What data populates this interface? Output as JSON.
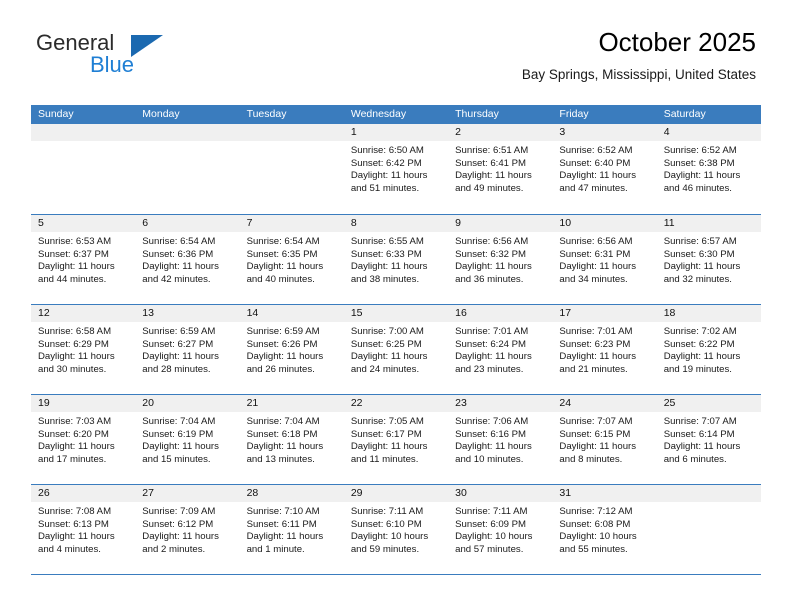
{
  "brand": {
    "name_part1": "General",
    "name_part2": "Blue",
    "logo_icon": "triangle-logo-icon"
  },
  "header": {
    "title": "October 2025",
    "subtitle": "Bay Springs, Mississippi, United States"
  },
  "colors": {
    "header_blue": "#3a7cbe",
    "brand_blue": "#1f7fd4",
    "logo_blue": "#1b69b0",
    "day_number_bg": "#f0f0f0",
    "page_bg": "#ffffff"
  },
  "calendar": {
    "weekdays": [
      "Sunday",
      "Monday",
      "Tuesday",
      "Wednesday",
      "Thursday",
      "Friday",
      "Saturday"
    ],
    "weeks": [
      [
        {
          "day": "",
          "empty": true,
          "sunrise": "",
          "sunset": "",
          "daylight1": "",
          "daylight2": ""
        },
        {
          "day": "",
          "empty": true,
          "sunrise": "",
          "sunset": "",
          "daylight1": "",
          "daylight2": ""
        },
        {
          "day": "",
          "empty": true,
          "sunrise": "",
          "sunset": "",
          "daylight1": "",
          "daylight2": ""
        },
        {
          "day": "1",
          "empty": false,
          "sunrise": "Sunrise: 6:50 AM",
          "sunset": "Sunset: 6:42 PM",
          "daylight1": "Daylight: 11 hours",
          "daylight2": "and 51 minutes."
        },
        {
          "day": "2",
          "empty": false,
          "sunrise": "Sunrise: 6:51 AM",
          "sunset": "Sunset: 6:41 PM",
          "daylight1": "Daylight: 11 hours",
          "daylight2": "and 49 minutes."
        },
        {
          "day": "3",
          "empty": false,
          "sunrise": "Sunrise: 6:52 AM",
          "sunset": "Sunset: 6:40 PM",
          "daylight1": "Daylight: 11 hours",
          "daylight2": "and 47 minutes."
        },
        {
          "day": "4",
          "empty": false,
          "sunrise": "Sunrise: 6:52 AM",
          "sunset": "Sunset: 6:38 PM",
          "daylight1": "Daylight: 11 hours",
          "daylight2": "and 46 minutes."
        }
      ],
      [
        {
          "day": "5",
          "empty": false,
          "sunrise": "Sunrise: 6:53 AM",
          "sunset": "Sunset: 6:37 PM",
          "daylight1": "Daylight: 11 hours",
          "daylight2": "and 44 minutes."
        },
        {
          "day": "6",
          "empty": false,
          "sunrise": "Sunrise: 6:54 AM",
          "sunset": "Sunset: 6:36 PM",
          "daylight1": "Daylight: 11 hours",
          "daylight2": "and 42 minutes."
        },
        {
          "day": "7",
          "empty": false,
          "sunrise": "Sunrise: 6:54 AM",
          "sunset": "Sunset: 6:35 PM",
          "daylight1": "Daylight: 11 hours",
          "daylight2": "and 40 minutes."
        },
        {
          "day": "8",
          "empty": false,
          "sunrise": "Sunrise: 6:55 AM",
          "sunset": "Sunset: 6:33 PM",
          "daylight1": "Daylight: 11 hours",
          "daylight2": "and 38 minutes."
        },
        {
          "day": "9",
          "empty": false,
          "sunrise": "Sunrise: 6:56 AM",
          "sunset": "Sunset: 6:32 PM",
          "daylight1": "Daylight: 11 hours",
          "daylight2": "and 36 minutes."
        },
        {
          "day": "10",
          "empty": false,
          "sunrise": "Sunrise: 6:56 AM",
          "sunset": "Sunset: 6:31 PM",
          "daylight1": "Daylight: 11 hours",
          "daylight2": "and 34 minutes."
        },
        {
          "day": "11",
          "empty": false,
          "sunrise": "Sunrise: 6:57 AM",
          "sunset": "Sunset: 6:30 PM",
          "daylight1": "Daylight: 11 hours",
          "daylight2": "and 32 minutes."
        }
      ],
      [
        {
          "day": "12",
          "empty": false,
          "sunrise": "Sunrise: 6:58 AM",
          "sunset": "Sunset: 6:29 PM",
          "daylight1": "Daylight: 11 hours",
          "daylight2": "and 30 minutes."
        },
        {
          "day": "13",
          "empty": false,
          "sunrise": "Sunrise: 6:59 AM",
          "sunset": "Sunset: 6:27 PM",
          "daylight1": "Daylight: 11 hours",
          "daylight2": "and 28 minutes."
        },
        {
          "day": "14",
          "empty": false,
          "sunrise": "Sunrise: 6:59 AM",
          "sunset": "Sunset: 6:26 PM",
          "daylight1": "Daylight: 11 hours",
          "daylight2": "and 26 minutes."
        },
        {
          "day": "15",
          "empty": false,
          "sunrise": "Sunrise: 7:00 AM",
          "sunset": "Sunset: 6:25 PM",
          "daylight1": "Daylight: 11 hours",
          "daylight2": "and 24 minutes."
        },
        {
          "day": "16",
          "empty": false,
          "sunrise": "Sunrise: 7:01 AM",
          "sunset": "Sunset: 6:24 PM",
          "daylight1": "Daylight: 11 hours",
          "daylight2": "and 23 minutes."
        },
        {
          "day": "17",
          "empty": false,
          "sunrise": "Sunrise: 7:01 AM",
          "sunset": "Sunset: 6:23 PM",
          "daylight1": "Daylight: 11 hours",
          "daylight2": "and 21 minutes."
        },
        {
          "day": "18",
          "empty": false,
          "sunrise": "Sunrise: 7:02 AM",
          "sunset": "Sunset: 6:22 PM",
          "daylight1": "Daylight: 11 hours",
          "daylight2": "and 19 minutes."
        }
      ],
      [
        {
          "day": "19",
          "empty": false,
          "sunrise": "Sunrise: 7:03 AM",
          "sunset": "Sunset: 6:20 PM",
          "daylight1": "Daylight: 11 hours",
          "daylight2": "and 17 minutes."
        },
        {
          "day": "20",
          "empty": false,
          "sunrise": "Sunrise: 7:04 AM",
          "sunset": "Sunset: 6:19 PM",
          "daylight1": "Daylight: 11 hours",
          "daylight2": "and 15 minutes."
        },
        {
          "day": "21",
          "empty": false,
          "sunrise": "Sunrise: 7:04 AM",
          "sunset": "Sunset: 6:18 PM",
          "daylight1": "Daylight: 11 hours",
          "daylight2": "and 13 minutes."
        },
        {
          "day": "22",
          "empty": false,
          "sunrise": "Sunrise: 7:05 AM",
          "sunset": "Sunset: 6:17 PM",
          "daylight1": "Daylight: 11 hours",
          "daylight2": "and 11 minutes."
        },
        {
          "day": "23",
          "empty": false,
          "sunrise": "Sunrise: 7:06 AM",
          "sunset": "Sunset: 6:16 PM",
          "daylight1": "Daylight: 11 hours",
          "daylight2": "and 10 minutes."
        },
        {
          "day": "24",
          "empty": false,
          "sunrise": "Sunrise: 7:07 AM",
          "sunset": "Sunset: 6:15 PM",
          "daylight1": "Daylight: 11 hours",
          "daylight2": "and 8 minutes."
        },
        {
          "day": "25",
          "empty": false,
          "sunrise": "Sunrise: 7:07 AM",
          "sunset": "Sunset: 6:14 PM",
          "daylight1": "Daylight: 11 hours",
          "daylight2": "and 6 minutes."
        }
      ],
      [
        {
          "day": "26",
          "empty": false,
          "sunrise": "Sunrise: 7:08 AM",
          "sunset": "Sunset: 6:13 PM",
          "daylight1": "Daylight: 11 hours",
          "daylight2": "and 4 minutes."
        },
        {
          "day": "27",
          "empty": false,
          "sunrise": "Sunrise: 7:09 AM",
          "sunset": "Sunset: 6:12 PM",
          "daylight1": "Daylight: 11 hours",
          "daylight2": "and 2 minutes."
        },
        {
          "day": "28",
          "empty": false,
          "sunrise": "Sunrise: 7:10 AM",
          "sunset": "Sunset: 6:11 PM",
          "daylight1": "Daylight: 11 hours",
          "daylight2": "and 1 minute."
        },
        {
          "day": "29",
          "empty": false,
          "sunrise": "Sunrise: 7:11 AM",
          "sunset": "Sunset: 6:10 PM",
          "daylight1": "Daylight: 10 hours",
          "daylight2": "and 59 minutes."
        },
        {
          "day": "30",
          "empty": false,
          "sunrise": "Sunrise: 7:11 AM",
          "sunset": "Sunset: 6:09 PM",
          "daylight1": "Daylight: 10 hours",
          "daylight2": "and 57 minutes."
        },
        {
          "day": "31",
          "empty": false,
          "sunrise": "Sunrise: 7:12 AM",
          "sunset": "Sunset: 6:08 PM",
          "daylight1": "Daylight: 10 hours",
          "daylight2": "and 55 minutes."
        },
        {
          "day": "",
          "empty": true,
          "sunrise": "",
          "sunset": "",
          "daylight1": "",
          "daylight2": ""
        }
      ]
    ]
  }
}
